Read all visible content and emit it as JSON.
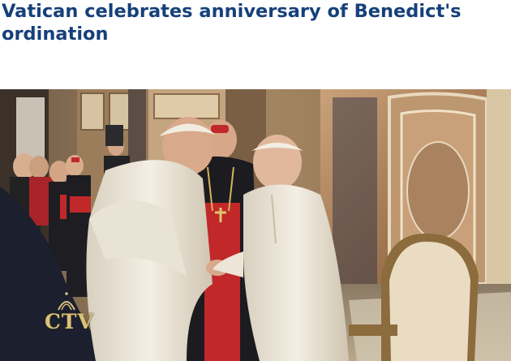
{
  "article": {
    "headline": "Vatican celebrates anniversary of Benedict's ordination"
  },
  "photo": {
    "watermark": "CTV",
    "watermark_color": "#d9c27a"
  },
  "colors": {
    "headline": "#16407a",
    "cassock_white": "#efe9dc",
    "cardinal_red": "#c0282a",
    "wall_marble": "#b08a5e",
    "chair_cream": "#e9dcc2"
  }
}
